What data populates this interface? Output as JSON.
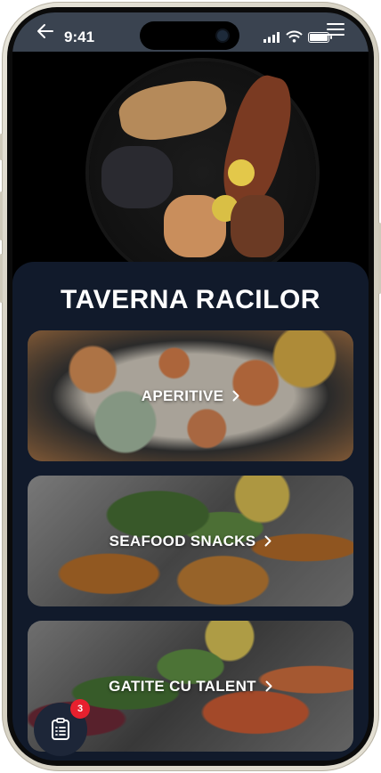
{
  "status_bar": {
    "time": "9:41"
  },
  "restaurant": {
    "name": "TAVERNA RACILOR"
  },
  "categories": [
    {
      "label": "APERITIVE"
    },
    {
      "label": "SEAFOOD SNACKS"
    },
    {
      "label": "GATITE CU TALENT"
    }
  ],
  "order": {
    "count": "3"
  },
  "icons": {
    "back": "arrow-left-icon",
    "menu": "hamburger-menu-icon",
    "chevron": "chevron-right-icon",
    "order": "clipboard-list-icon"
  },
  "colors": {
    "panel": "#111a2b",
    "status_bar": "#3a4350",
    "badge": "#e8202e",
    "fab": "#1d2638"
  }
}
